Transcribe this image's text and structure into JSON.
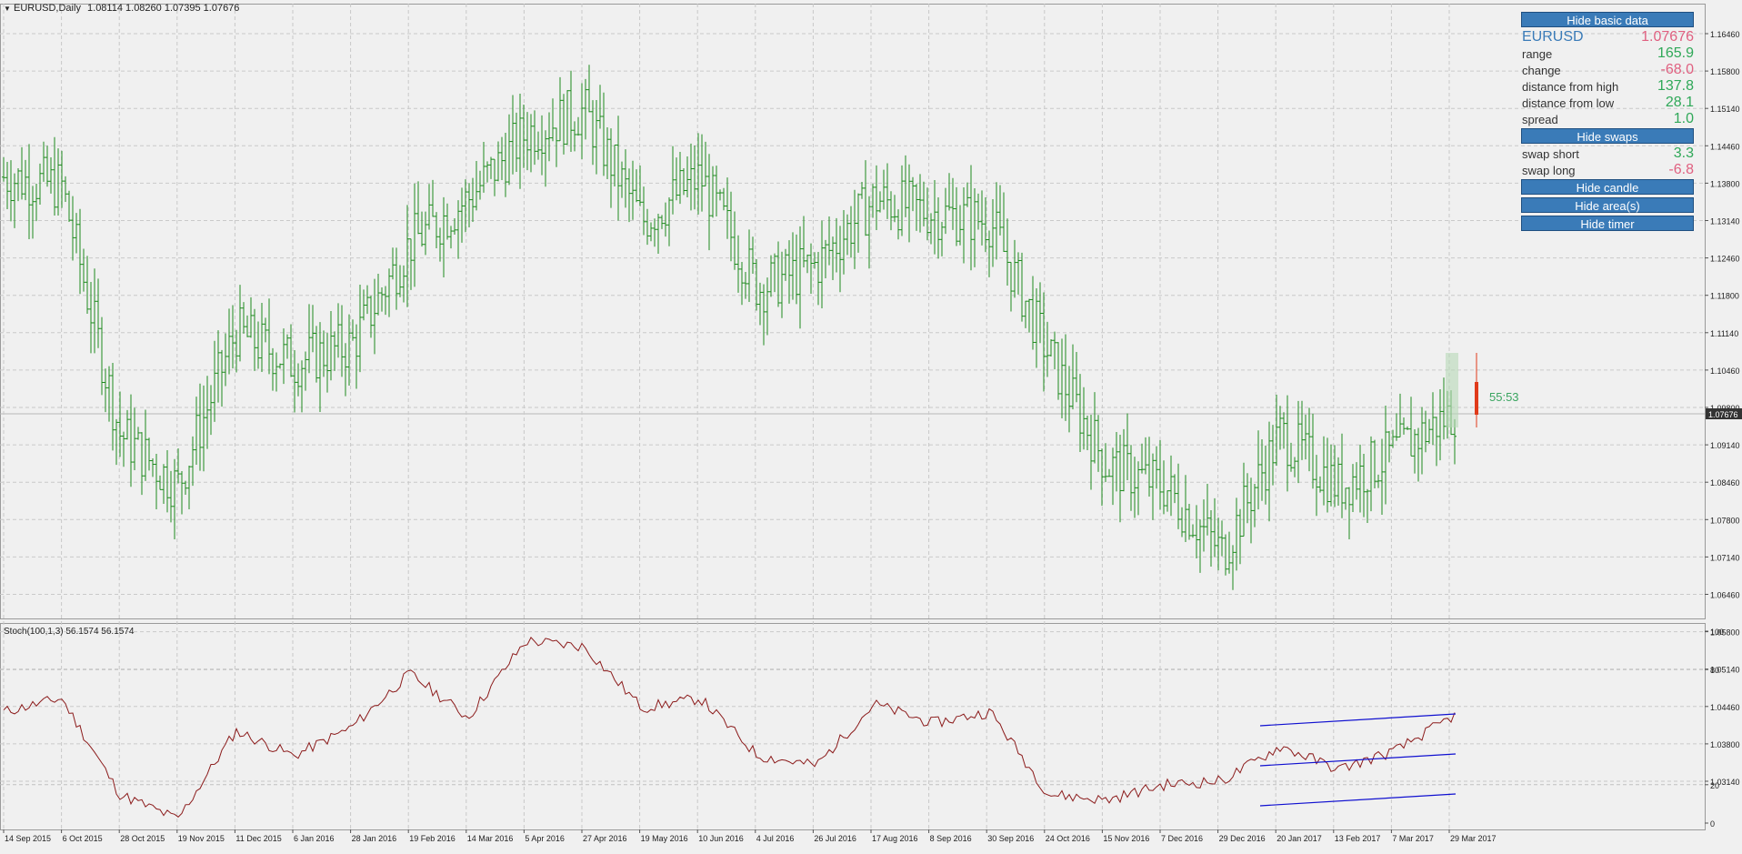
{
  "header": {
    "symbol_tf": "EURUSD,Daily",
    "ohlc": "1.08114 1.08260 1.07395 1.07676"
  },
  "indicator": {
    "label": "Stoch(100,1,3) 56.1574 56.1574"
  },
  "price_axis": {
    "ticks": [
      "1.16460",
      "1.15800",
      "1.15140",
      "1.14460",
      "1.13800",
      "1.13140",
      "1.12460",
      "1.11800",
      "1.11140",
      "1.10460",
      "1.09800",
      "1.09140",
      "1.08460",
      "1.07800",
      "1.07140",
      "1.06460",
      "1.05800",
      "1.05140",
      "1.04460",
      "1.03800",
      "1.03140"
    ],
    "current_price": "1.07676"
  },
  "stoch_axis": {
    "ticks": [
      "100",
      "80",
      "20",
      "0"
    ]
  },
  "time_axis": {
    "labels": [
      "14 Sep 2015",
      "6 Oct 2015",
      "28 Oct 2015",
      "19 Nov 2015",
      "11 Dec 2015",
      "6 Jan 2016",
      "28 Jan 2016",
      "19 Feb 2016",
      "14 Mar 2016",
      "5 Apr 2016",
      "27 Apr 2016",
      "19 May 2016",
      "10 Jun 2016",
      "4 Jul 2016",
      "26 Jul 2016",
      "17 Aug 2016",
      "8 Sep 2016",
      "30 Sep 2016",
      "24 Oct 2016",
      "15 Nov 2016",
      "7 Dec 2016",
      "29 Dec 2016",
      "20 Jan 2017",
      "13 Feb 2017",
      "7 Mar 2017",
      "29 Mar 2017"
    ]
  },
  "timer": {
    "text": "55:53"
  },
  "panel": {
    "hide_basic": "Hide basic data",
    "symbol": "EURUSD",
    "price": "1.07676",
    "range_label": "range",
    "range_value": "165.9",
    "change_label": "change",
    "change_value": "-68.0",
    "dist_high_label": "distance from high",
    "dist_high_value": "137.8",
    "dist_low_label": "distance from low",
    "dist_low_value": "28.1",
    "spread_label": "spread",
    "spread_value": "1.0",
    "hide_swaps": "Hide swaps",
    "swap_short_label": "swap short",
    "swap_short_value": "3.3",
    "swap_long_label": "swap long",
    "swap_long_value": "-6.8",
    "hide_candle": "Hide candle",
    "hide_areas": "Hide area(s)",
    "hide_timer": "Hide timer"
  },
  "colors": {
    "bull_bar": "#1e8a1e",
    "bear_bar": "#e03a1a",
    "stoch_line": "#8b1a1a",
    "trend_lines": "#1010d0",
    "panel_button": "#3a7bb8"
  },
  "chart_data": {
    "type": "line",
    "x": [
      "14 Sep 2015",
      "6 Oct 2015",
      "28 Oct 2015",
      "19 Nov 2015",
      "11 Dec 2015",
      "6 Jan 2016",
      "28 Jan 2016",
      "19 Feb 2016",
      "14 Mar 2016",
      "5 Apr 2016",
      "27 Apr 2016",
      "19 May 2016",
      "10 Jun 2016",
      "4 Jul 2016",
      "26 Jul 2016",
      "17 Aug 2016",
      "8 Sep 2016",
      "30 Sep 2016",
      "24 Oct 2016",
      "15 Nov 2016",
      "7 Dec 2016",
      "29 Dec 2016",
      "20 Jan 2017",
      "13 Feb 2017",
      "7 Mar 2017",
      "29 Mar 2017"
    ],
    "series": [
      {
        "name": "EURUSD",
        "values": [
          1.13,
          1.128,
          1.072,
          1.06,
          1.095,
          1.088,
          1.092,
          1.115,
          1.125,
          1.14,
          1.145,
          1.12,
          1.13,
          1.105,
          1.11,
          1.125,
          1.122,
          1.12,
          1.09,
          1.065,
          1.06,
          1.045,
          1.072,
          1.06,
          1.068,
          1.077
        ]
      },
      {
        "name": "Stoch(100,1,3)",
        "values": [
          58,
          65,
          15,
          2,
          48,
          35,
          50,
          78,
          55,
          95,
          92,
          60,
          65,
          35,
          30,
          62,
          52,
          58,
          15,
          12,
          20,
          22,
          40,
          28,
          38,
          56.1574
        ]
      }
    ],
    "ylim": [
      1.0314,
      1.168
    ]
  }
}
